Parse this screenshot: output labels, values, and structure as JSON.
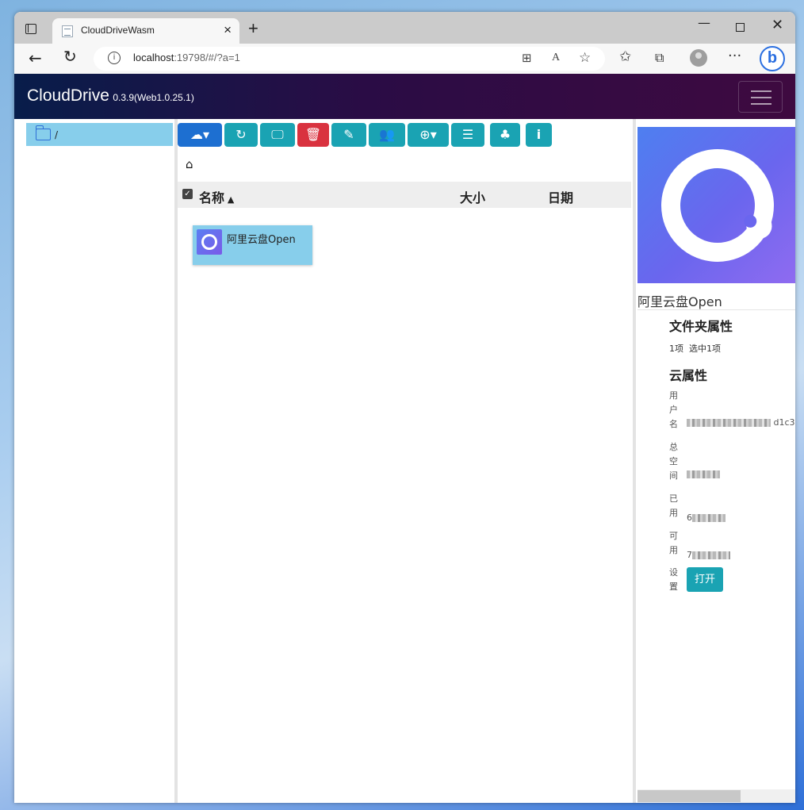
{
  "browser": {
    "tab_title": "CloudDriveWasm",
    "close_glyph": "×",
    "new_tab_glyph": "+",
    "url_host": "localhost",
    "url_rest": ":19798/#/?a=1",
    "icons": [
      "tab-actions-icon",
      "info-icon",
      "split-screen-icon",
      "read-aloud-icon",
      "add-favorite-icon",
      "favorites-icon",
      "collections-icon",
      "profile-icon",
      "more-icon",
      "bing-icon"
    ]
  },
  "app": {
    "brand": "CloudDrive",
    "version": "0.3.9(Web1.0.25.1)"
  },
  "tree": {
    "root_label": "/"
  },
  "toolbar_buttons": [
    {
      "name": "cloud-menu-button",
      "icon": "cloud-icon"
    },
    {
      "name": "refresh-button",
      "icon": "refresh-icon"
    },
    {
      "name": "desktop-button",
      "icon": "desktop-icon"
    },
    {
      "name": "delete-button",
      "icon": "trash-icon"
    },
    {
      "name": "edit-button",
      "icon": "edit-icon"
    },
    {
      "name": "share-button",
      "icon": "people-icon"
    },
    {
      "name": "zoom-menu-button",
      "icon": "zoom-icon"
    },
    {
      "name": "list-view-button",
      "icon": "list-icon"
    },
    {
      "name": "tree-view-button",
      "icon": "tree-icon"
    },
    {
      "name": "info-button",
      "icon": "info-icon"
    }
  ],
  "list": {
    "col_name": "名称",
    "col_size": "大小",
    "col_date": "日期",
    "items": [
      {
        "name": "阿里云盘Open"
      }
    ]
  },
  "detail": {
    "name": "阿里云盘Open",
    "folder_props_title": "文件夹属性",
    "count": "1项",
    "selected": "选中1项",
    "cloud_props_title": "云属性",
    "username_label": "用户名",
    "username_value_tail": "d1c3",
    "total_label": "总空间",
    "used_label": "已用",
    "used_value_prefix": "6",
    "available_label": "可用",
    "available_value_prefix": "7",
    "settings_label": "设置",
    "open_button": "打开"
  },
  "colors": {
    "header_start": "#081d4a",
    "header_end": "#3e0a40",
    "selection": "#87ceeb",
    "primary": "#1d6fd1",
    "teal": "#1aa3b3",
    "danger": "#d9323f"
  }
}
